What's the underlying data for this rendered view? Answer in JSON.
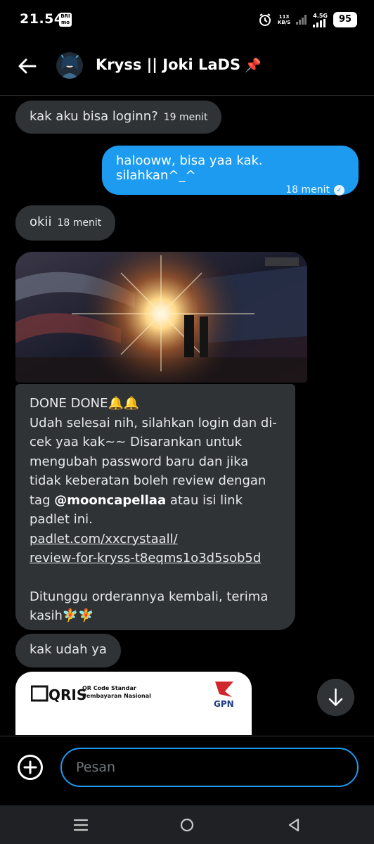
{
  "status": {
    "time": "21.54",
    "bank_icon_label_top": "BRI",
    "bank_icon_label_bottom": "mo",
    "net_speed_value": "113",
    "net_speed_unit": "KB/S",
    "net_type": "4.5G",
    "battery": "95"
  },
  "header": {
    "contact_name": "Kryss || Joki LaDS",
    "pin_emoji": "📌"
  },
  "messages": [
    {
      "direction": "in",
      "text": "kak aku bisa loginn?",
      "time": "19 menit"
    },
    {
      "direction": "out",
      "text": "halooww, bisa yaa kak. silahkan^_^",
      "time": "18 menit",
      "status": "read"
    },
    {
      "direction": "in",
      "text": "okii",
      "time": "18 menit"
    }
  ],
  "media_message": {
    "line1": "DONE DONE🔔🔔",
    "body_part1": "Udah selesai nih, silahkan login dan di-cek yaa kak~~ Disarankan untuk mengubah password baru dan jika tidak keberatan boleh review dengan tag ",
    "mention": "@mooncapellaa",
    "body_part2": " atau isi link padlet ini.",
    "link_line1": "padlet.com/xxcrystaall/",
    "link_line2": "review-for-kryss-t8eqms1o3d5sob5d",
    "closing": "Ditunggu orderannya kembali, terima kasih🧚🧚"
  },
  "message_last": {
    "direction": "in",
    "text": "kak udah ya"
  },
  "qris": {
    "logo_text": "QRIS",
    "title_line1": "QR Code Standar",
    "title_line2": "Pembayaran Nasional",
    "gpn_label": "GPN"
  },
  "composer": {
    "placeholder": "Pesan"
  },
  "colors": {
    "accent": "#1d9bf0",
    "incoming_bubble": "#2f3336",
    "background": "#000000"
  }
}
